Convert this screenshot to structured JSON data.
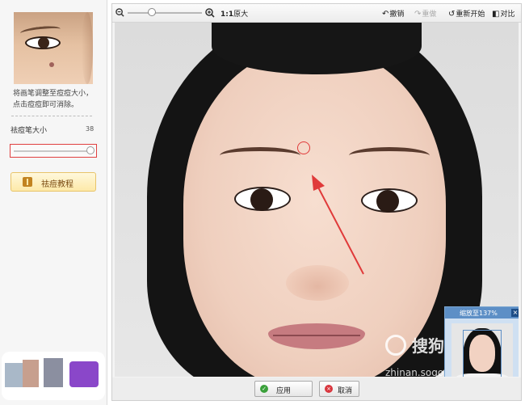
{
  "left_panel": {
    "hint_line1": "将画笔调整至痘痘大小，",
    "hint_line2": "点击痘痘即可消除。",
    "brush_size_label": "祛痘笔大小",
    "brush_size_value": "38",
    "brush_size_level": 1.0,
    "tutorial_button": "祛痘教程"
  },
  "toolbar": {
    "zoom_level": 0.3,
    "original_prefix": "1:1",
    "original_label": "原大",
    "undo_label": "撤销",
    "redo_label": "重做",
    "restart_label": "重新开始",
    "compare_label": "对比"
  },
  "navigator": {
    "title": "缩放至137%",
    "close": "×"
  },
  "watermark": {
    "brand": "搜狗指南",
    "url": "zhinan.sogou.com"
  },
  "actions": {
    "apply_label": "应用",
    "cancel_label": "取消"
  },
  "colors": {
    "accent_red": "#e03a3a",
    "apply_icon": "#3aa03a",
    "cancel_icon": "#d9363e",
    "nav_blue": "#5d8fc6"
  }
}
